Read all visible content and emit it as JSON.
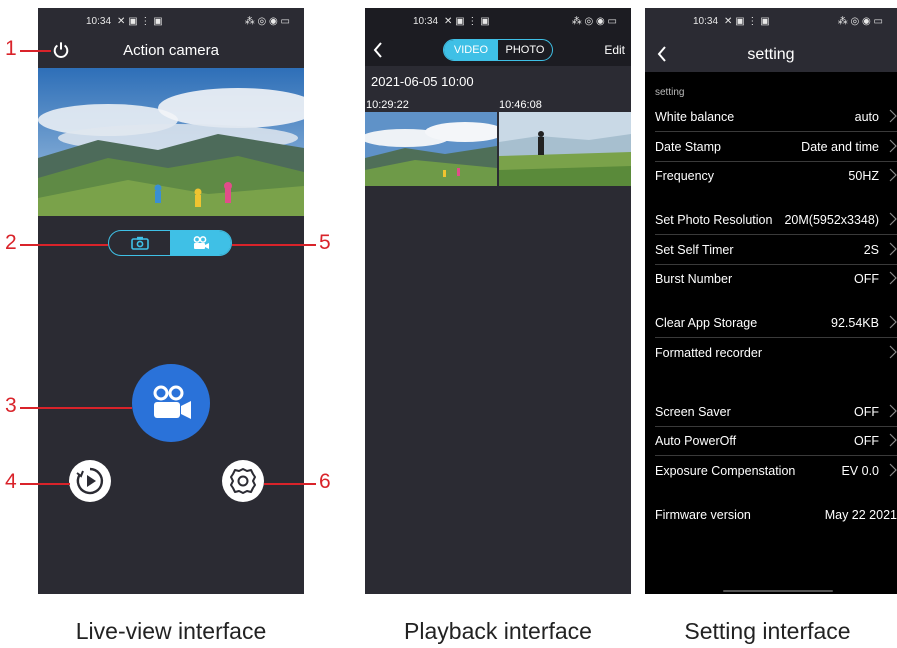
{
  "colors": {
    "accent": "#3fc0e6",
    "record": "#2a72d9",
    "annotation": "#d9232a",
    "panel": "#2b2b33"
  },
  "status": {
    "time": "10:34",
    "left_icons": "✕ ▣ ⋮ ▣",
    "right_icons": "⁂ ◎ ◉ ▭"
  },
  "live": {
    "title": "Action camera",
    "caption": "Live-view interface",
    "annotations": [
      "1",
      "2",
      "3",
      "4",
      "5",
      "6"
    ],
    "icons": {
      "power": "power-icon",
      "photo_mode": "camera-icon",
      "video_mode": "video-camera-icon",
      "record": "video-camera-icon",
      "playback": "play-circle-icon",
      "settings": "gear-icon"
    }
  },
  "playback": {
    "caption": "Playback interface",
    "tabs": [
      "VIDEO",
      "PHOTO"
    ],
    "edit_label": "Edit",
    "date": "2021-06-05 10:00",
    "thumbs": [
      {
        "time": "10:29:22"
      },
      {
        "time": "10:46:08"
      }
    ]
  },
  "settings": {
    "caption": "Setting interface",
    "title": "setting",
    "section": "setting",
    "rows": [
      {
        "label": "White balance",
        "value": "auto"
      },
      {
        "label": "Date Stamp",
        "value": "Date and time"
      },
      {
        "label": "Frequency",
        "value": "50HZ"
      },
      {
        "label": "Set Photo Resolution",
        "value": "20M(5952x3348)"
      },
      {
        "label": "Set Self Timer",
        "value": "2S"
      },
      {
        "label": "Burst Number",
        "value": "OFF"
      },
      {
        "label": "Clear App Storage",
        "value": "92.54KB"
      },
      {
        "label": "Formatted recorder",
        "value": ""
      },
      {
        "label": "Screen Saver",
        "value": "OFF"
      },
      {
        "label": "Auto PowerOff",
        "value": "OFF"
      },
      {
        "label": "Exposure Compenstation",
        "value": "EV 0.0"
      },
      {
        "label": "Firmware version",
        "value": "May 22 2021"
      }
    ]
  }
}
